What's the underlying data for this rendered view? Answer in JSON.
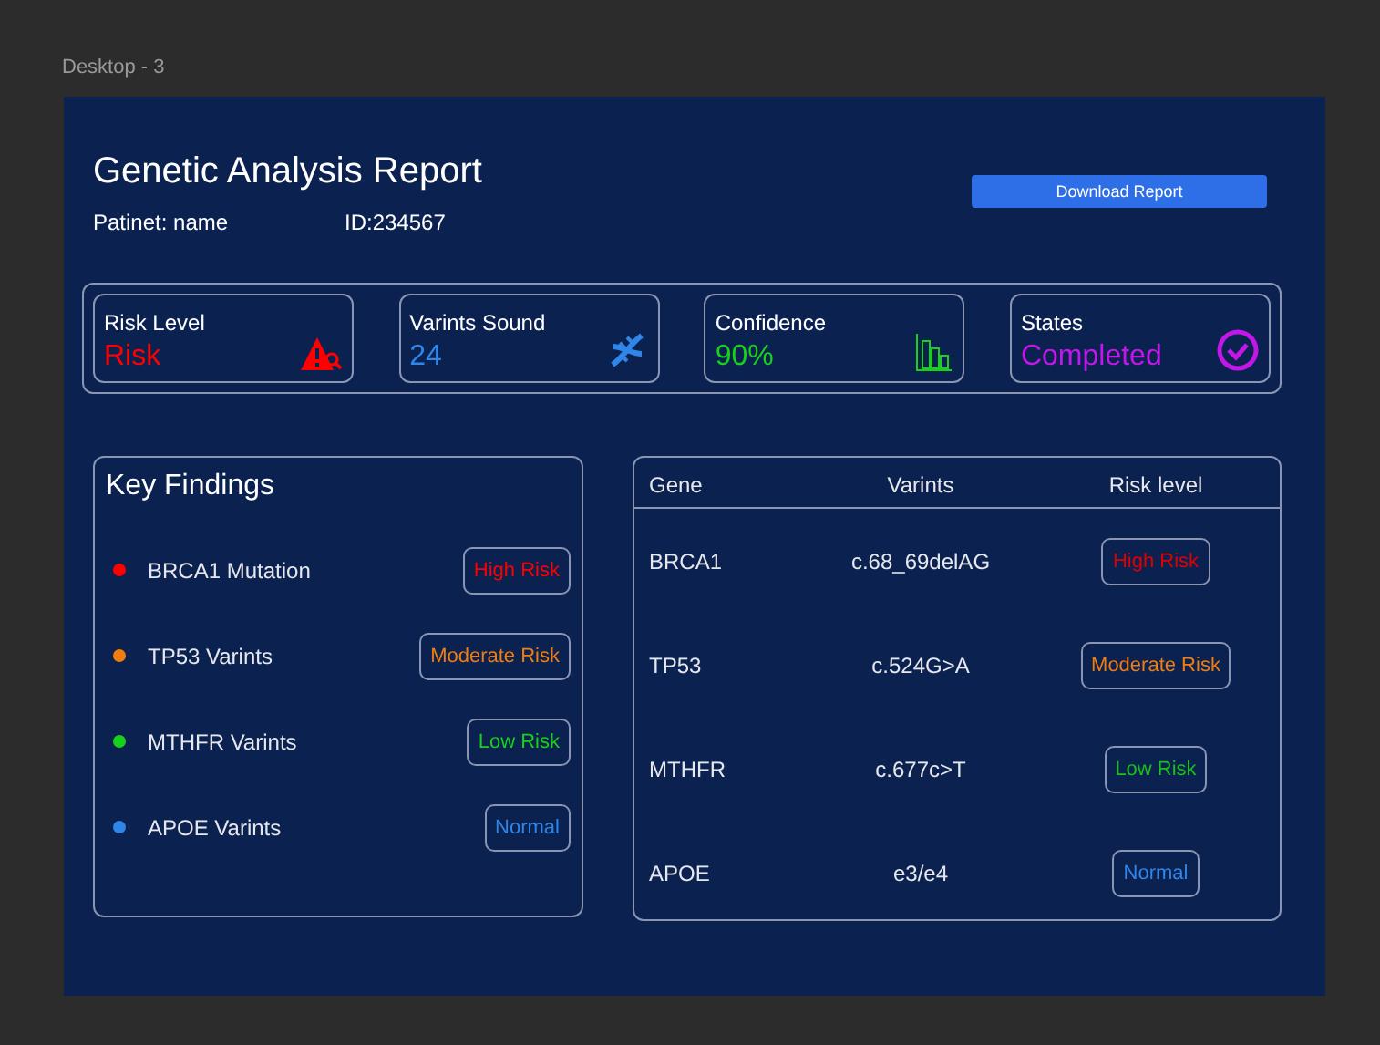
{
  "canvas": {
    "frame_label": "Desktop - 3"
  },
  "header": {
    "title": "Genetic Analysis Report",
    "patient": "Patinet: name",
    "id": "ID:234567",
    "download_button": "Download Report"
  },
  "stats": [
    {
      "kind": "risk",
      "label": "Risk Level",
      "value": "Risk",
      "color": "#ff0000"
    },
    {
      "kind": "variants",
      "label": "Varints Sound",
      "value": "24",
      "color": "#2f86e8"
    },
    {
      "kind": "confidence",
      "label": "Confidence",
      "value": "90%",
      "color": "#17d11a"
    },
    {
      "kind": "status",
      "label": "States",
      "value": "Completed",
      "color": "#c316e8"
    }
  ],
  "key_findings": {
    "title": "Key Findings",
    "items": [
      {
        "label": "BRCA1 Mutation",
        "badge": "High Risk",
        "color": "#ff0000"
      },
      {
        "label": "TP53 Varints",
        "badge": "Moderate Risk",
        "color": "#f07d10"
      },
      {
        "label": "MTHFR Varints",
        "badge": "Low Risk",
        "color": "#17d11a"
      },
      {
        "label": "APOE Varints",
        "badge": "Normal",
        "color": "#2f86e8"
      }
    ]
  },
  "table": {
    "columns": [
      "Gene",
      "Varints",
      "Risk level"
    ],
    "rows": [
      {
        "gene": "BRCA1",
        "variant": "c.68_69delAG",
        "risk": "High Risk",
        "color": "#e00000"
      },
      {
        "gene": "TP53",
        "variant": "c.524G>A",
        "risk": "Moderate Risk",
        "color": "#f07d10"
      },
      {
        "gene": "MTHFR",
        "variant": "c.677c>T",
        "risk": "Low Risk",
        "color": "#17c11a"
      },
      {
        "gene": "APOE",
        "variant": "e3/e4",
        "risk": "Normal",
        "color": "#2f86e8"
      }
    ]
  }
}
